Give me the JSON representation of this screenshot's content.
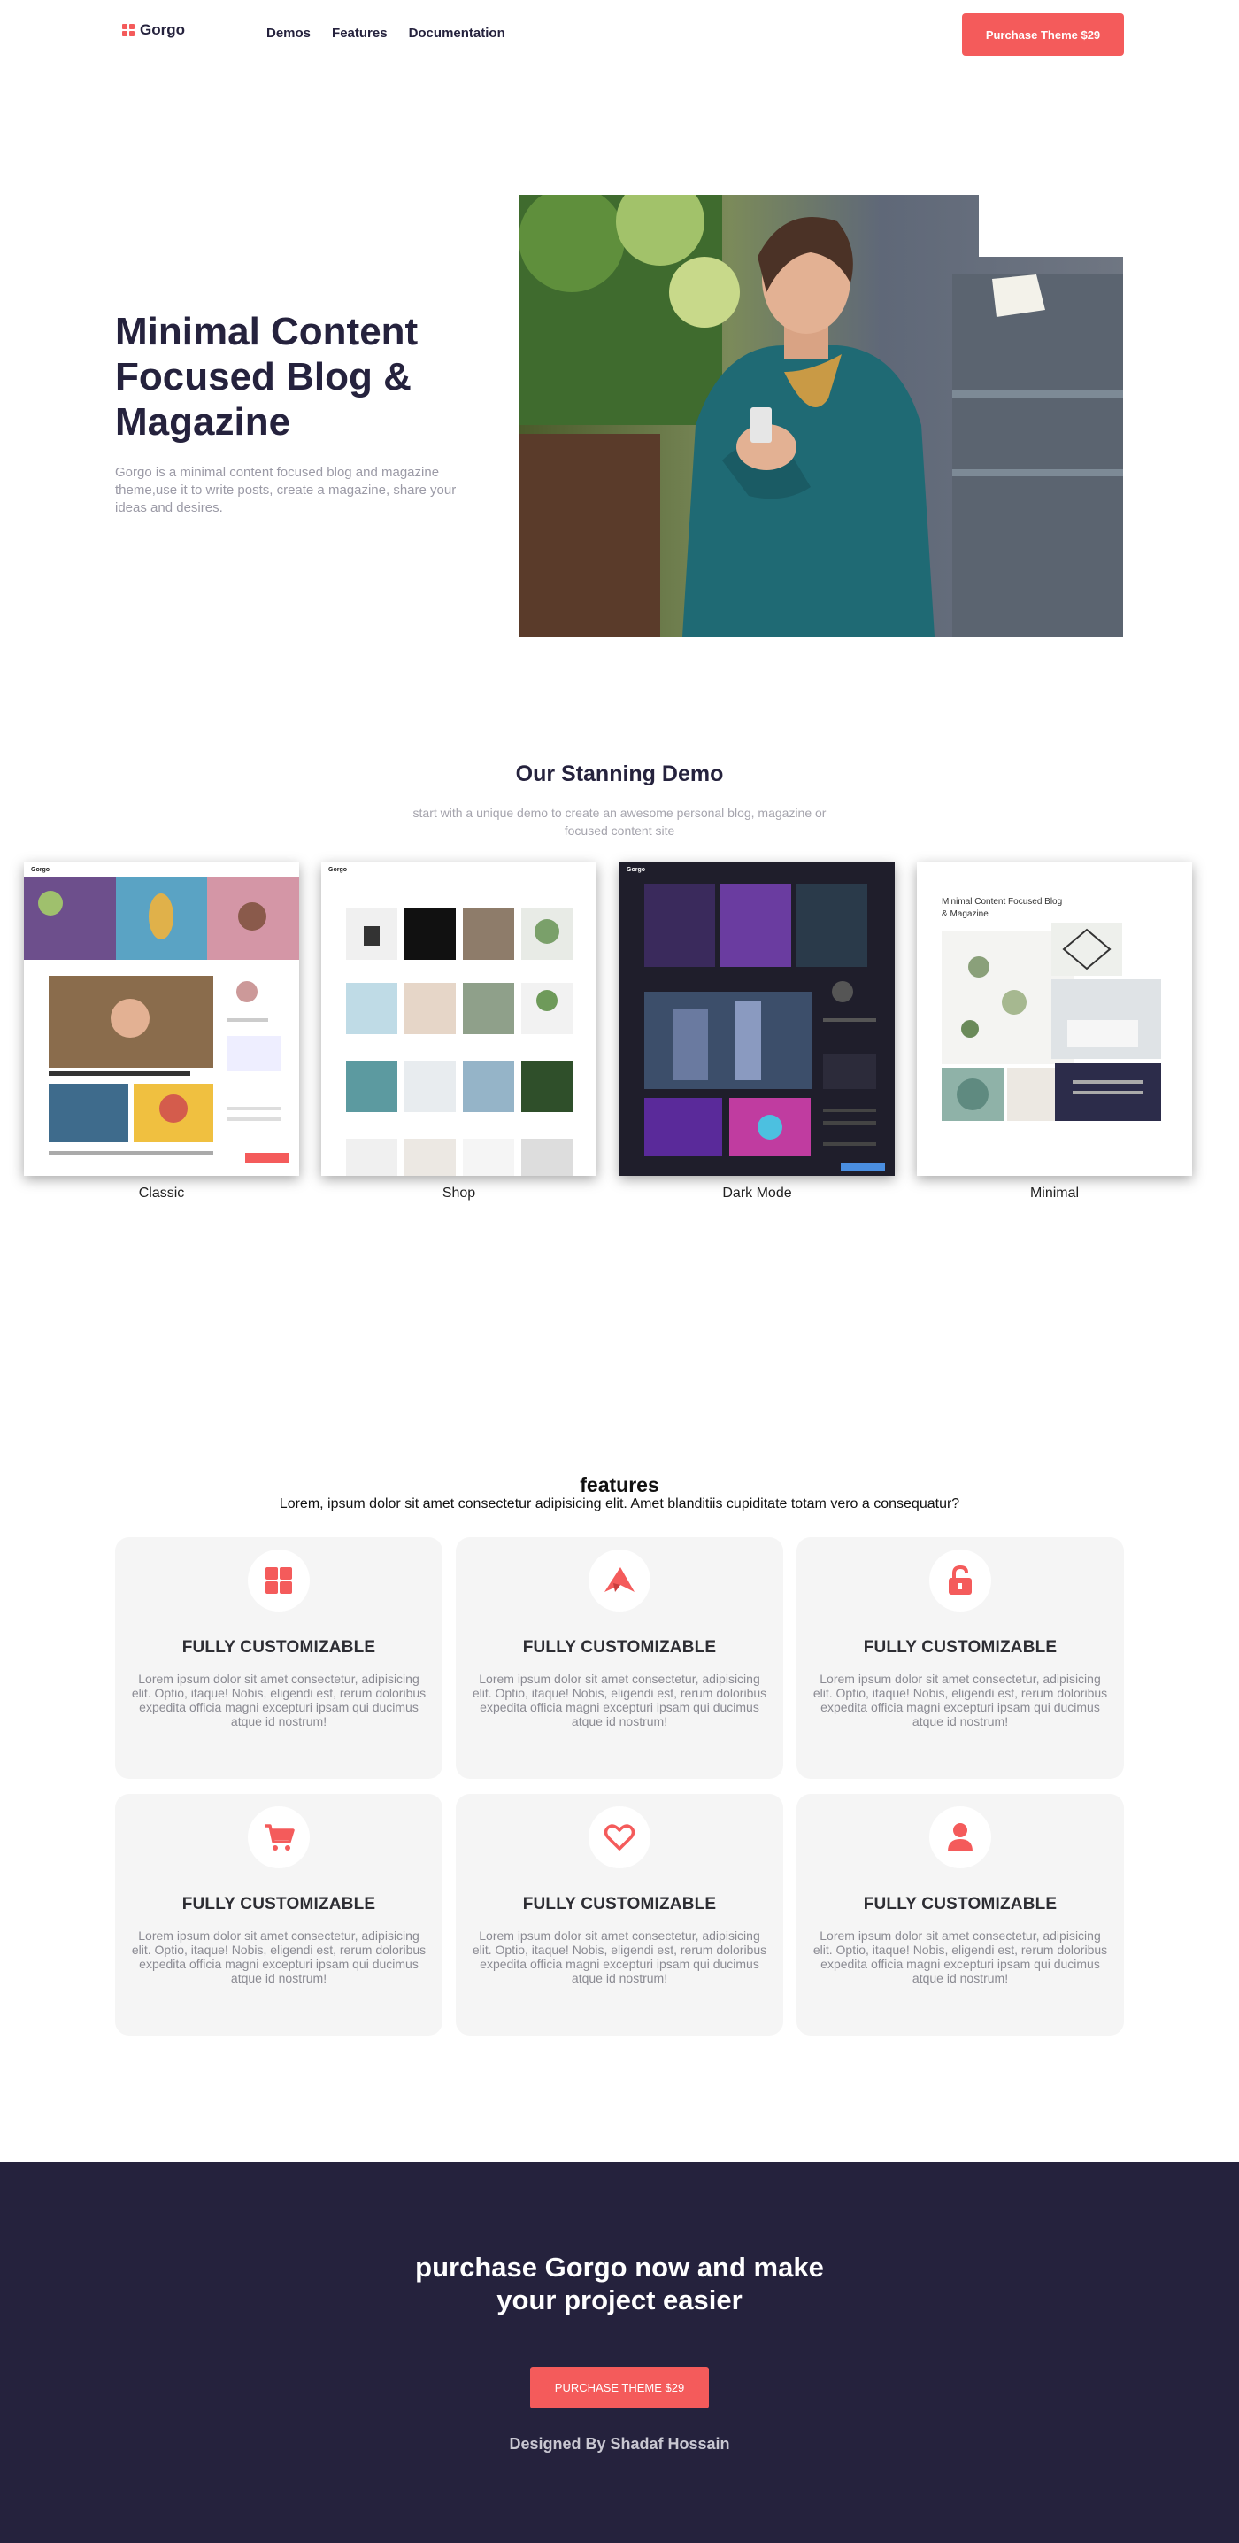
{
  "header": {
    "logo_text": "Gorgo",
    "nav": [
      "Demos",
      "Features",
      "Documentation"
    ],
    "purchase_label": "Purchase Theme $29"
  },
  "hero": {
    "title": "Minimal Content Focused Blog & Magazine",
    "description": "Gorgo is a minimal content focused blog and magazine theme,use it to write posts, create a magazine, share your ideas and desires."
  },
  "demos": {
    "title": "Our Stanning Demo",
    "subtitle": "start with a unique demo to create an awesome personal blog, magazine or focused content site",
    "items": [
      {
        "label": "Classic",
        "logo": "Gorgo"
      },
      {
        "label": "Shop",
        "logo": "Gorgo"
      },
      {
        "label": "Dark Mode",
        "logo": "Gorgo"
      },
      {
        "label": "Minimal",
        "heading": "Minimal Content Focused Blog & Magazine"
      }
    ]
  },
  "features": {
    "title": "features",
    "subtitle": "Lorem, ipsum dolor sit amet consectetur adipisicing elit. Amet blanditiis cupiditate totam vero a consequatur?",
    "cards": [
      {
        "icon": "grid-icon",
        "title": "FULLY CUSTOMIZABLE",
        "text": "Lorem ipsum dolor sit amet consectetur, adipisicing elit. Optio, itaque! Nobis, eligendi est, rerum doloribus expedita officia magni excepturi ipsam qui ducimus atque id nostrum!"
      },
      {
        "icon": "paper-plane-icon",
        "title": "FULLY CUSTOMIZABLE",
        "text": "Lorem ipsum dolor sit amet consectetur, adipisicing elit. Optio, itaque! Nobis, eligendi est, rerum doloribus expedita officia magni excepturi ipsam qui ducimus atque id nostrum!"
      },
      {
        "icon": "unlock-icon",
        "title": "FULLY CUSTOMIZABLE",
        "text": "Lorem ipsum dolor sit amet consectetur, adipisicing elit. Optio, itaque! Nobis, eligendi est, rerum doloribus expedita officia magni excepturi ipsam qui ducimus atque id nostrum!"
      },
      {
        "icon": "cart-icon",
        "title": "FULLY CUSTOMIZABLE",
        "text": "Lorem ipsum dolor sit amet consectetur, adipisicing elit. Optio, itaque! Nobis, eligendi est, rerum doloribus expedita officia magni excepturi ipsam qui ducimus atque id nostrum!"
      },
      {
        "icon": "heart-icon",
        "title": "FULLY CUSTOMIZABLE",
        "text": "Lorem ipsum dolor sit amet consectetur, adipisicing elit. Optio, itaque! Nobis, eligendi est, rerum doloribus expedita officia magni excepturi ipsam qui ducimus atque id nostrum!"
      },
      {
        "icon": "user-icon",
        "title": "FULLY CUSTOMIZABLE",
        "text": "Lorem ipsum dolor sit amet consectetur, adipisicing elit. Optio, itaque! Nobis, eligendi est, rerum doloribus expedita officia magni excepturi ipsam qui ducimus atque id nostrum!"
      }
    ]
  },
  "footer": {
    "title": "purchase Gorgo now and make your project easier",
    "button_label": "PURCHASE THEME $29",
    "credit": "Designed By Shadaf Hossain"
  },
  "colors": {
    "accent": "#f45b5b",
    "dark": "#25223d",
    "card_bg": "#f5f5f5"
  }
}
